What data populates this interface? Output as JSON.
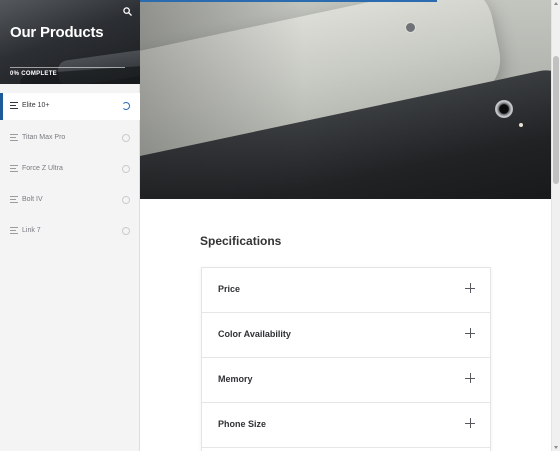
{
  "sidebar": {
    "title": "Our Products",
    "progress": {
      "percent": 0,
      "label": "0% COMPLETE"
    },
    "lessons": [
      {
        "label": "Elite 10+",
        "active": true,
        "status": "in-progress"
      },
      {
        "label": "Titan Max Pro",
        "active": false,
        "status": "not-started"
      },
      {
        "label": "Force Z Ultra",
        "active": false,
        "status": "not-started"
      },
      {
        "label": "Bolt IV",
        "active": false,
        "status": "not-started"
      },
      {
        "label": "Link 7",
        "active": false,
        "status": "not-started"
      }
    ]
  },
  "icons": {
    "search": "search-icon",
    "lesson": "lines-icon",
    "expand": "plus-icon"
  },
  "main": {
    "section_title": "Specifications",
    "accordion": [
      {
        "label": "Price"
      },
      {
        "label": "Color Availability"
      },
      {
        "label": "Memory"
      },
      {
        "label": "Phone Size"
      }
    ]
  },
  "colors": {
    "accent": "#2b6cb0",
    "sidebar_bg": "#f4f4f5",
    "text": "#333333"
  }
}
